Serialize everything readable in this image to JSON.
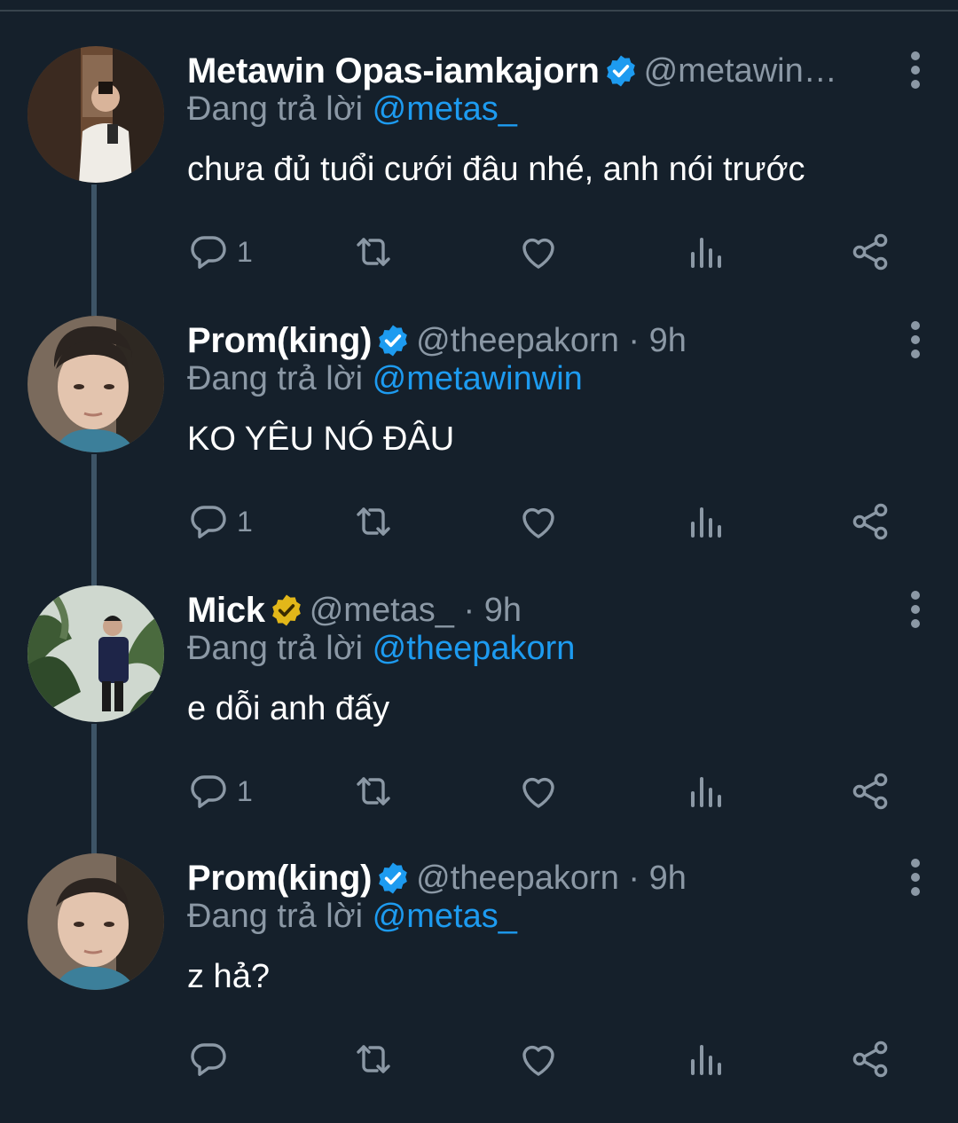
{
  "reply_prefix": "Đang trả lời",
  "colors": {
    "background": "#15202b",
    "accent": "#1d9bf0",
    "muted": "#8b98a5",
    "gold_badge": "#e2b719"
  },
  "tweets": [
    {
      "name": "Metawin Opas-iamkajorn",
      "badge": "blue-verified-icon",
      "handle": "@metawin…",
      "replying_to": "@metas_",
      "text": "chưa đủ tuổi cưới đâu nhé, anh nói trước",
      "reply_count": "1"
    },
    {
      "name": "Prom(king)",
      "badge": "blue-verified-icon",
      "handle": "@theepakorn · 9h",
      "replying_to": "@metawinwin",
      "text": "KO YÊU NÓ ĐÂU",
      "reply_count": "1"
    },
    {
      "name": "Mick",
      "badge": "gold-verified-icon",
      "handle": "@metas_ · 9h",
      "replying_to": "@theepakorn",
      "text": "e dỗi anh đấy",
      "reply_count": "1"
    },
    {
      "name": "Prom(king)",
      "badge": "blue-verified-icon",
      "handle": "@theepakorn · 9h",
      "replying_to": "@metas_",
      "text": "z hả?",
      "reply_count": ""
    }
  ]
}
